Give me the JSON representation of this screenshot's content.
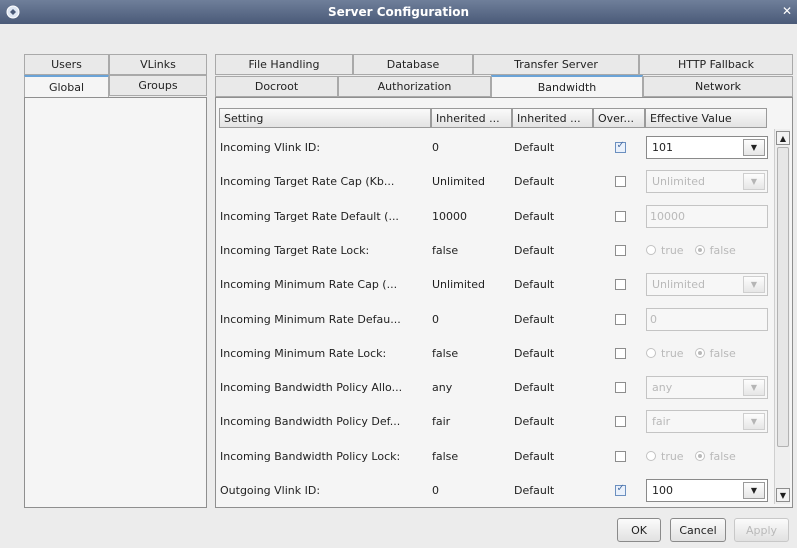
{
  "window": {
    "title": "Server Configuration"
  },
  "left_tabs": {
    "row1": [
      "Users",
      "VLinks"
    ],
    "row2": [
      "Global",
      "Groups"
    ],
    "selected": "Global"
  },
  "right_tabs": {
    "row1": [
      "File Handling",
      "Database",
      "Transfer Server",
      "HTTP Fallback"
    ],
    "row2": [
      "Docroot",
      "Authorization",
      "Bandwidth",
      "Network"
    ],
    "selected": "Bandwidth"
  },
  "table": {
    "headers": [
      "Setting",
      "Inherited ...",
      "Inherited ...",
      "Over...",
      "Effective Value"
    ],
    "rows": [
      {
        "setting": "Incoming Vlink ID:",
        "inherited": "0",
        "inherited_from": "Default",
        "override": true,
        "effective_type": "combo",
        "effective": "101",
        "enabled": true
      },
      {
        "setting": "Incoming Target Rate Cap (Kb...",
        "inherited": "Unlimited",
        "inherited_from": "Default",
        "override": false,
        "effective_type": "combo",
        "effective": "Unlimited",
        "enabled": false
      },
      {
        "setting": "Incoming Target Rate Default (...",
        "inherited": "10000",
        "inherited_from": "Default",
        "override": false,
        "effective_type": "text",
        "effective": "10000",
        "enabled": false
      },
      {
        "setting": "Incoming Target Rate Lock:",
        "inherited": "false",
        "inherited_from": "Default",
        "override": false,
        "effective_type": "radio",
        "effective": "false",
        "enabled": false
      },
      {
        "setting": "Incoming Minimum Rate Cap (...",
        "inherited": "Unlimited",
        "inherited_from": "Default",
        "override": false,
        "effective_type": "combo",
        "effective": "Unlimited",
        "enabled": false
      },
      {
        "setting": "Incoming Minimum Rate Defau...",
        "inherited": "0",
        "inherited_from": "Default",
        "override": false,
        "effective_type": "text",
        "effective": "0",
        "enabled": false
      },
      {
        "setting": "Incoming Minimum Rate Lock:",
        "inherited": "false",
        "inherited_from": "Default",
        "override": false,
        "effective_type": "radio",
        "effective": "false",
        "enabled": false
      },
      {
        "setting": "Incoming Bandwidth Policy Allo...",
        "inherited": "any",
        "inherited_from": "Default",
        "override": false,
        "effective_type": "combo",
        "effective": "any",
        "enabled": false
      },
      {
        "setting": "Incoming Bandwidth Policy Def...",
        "inherited": "fair",
        "inherited_from": "Default",
        "override": false,
        "effective_type": "combo",
        "effective": "fair",
        "enabled": false
      },
      {
        "setting": "Incoming Bandwidth Policy Lock:",
        "inherited": "false",
        "inherited_from": "Default",
        "override": false,
        "effective_type": "radio",
        "effective": "false",
        "enabled": false
      },
      {
        "setting": "Outgoing Vlink ID:",
        "inherited": "0",
        "inherited_from": "Default",
        "override": true,
        "effective_type": "combo",
        "effective": "100",
        "enabled": true
      }
    ]
  },
  "radio_labels": {
    "true": "true",
    "false": "false"
  },
  "buttons": {
    "ok": "OK",
    "cancel": "Cancel",
    "apply": "Apply"
  },
  "colors": {
    "titlebar": "#4a5a78",
    "tab_accent": "#6aa3d7"
  }
}
